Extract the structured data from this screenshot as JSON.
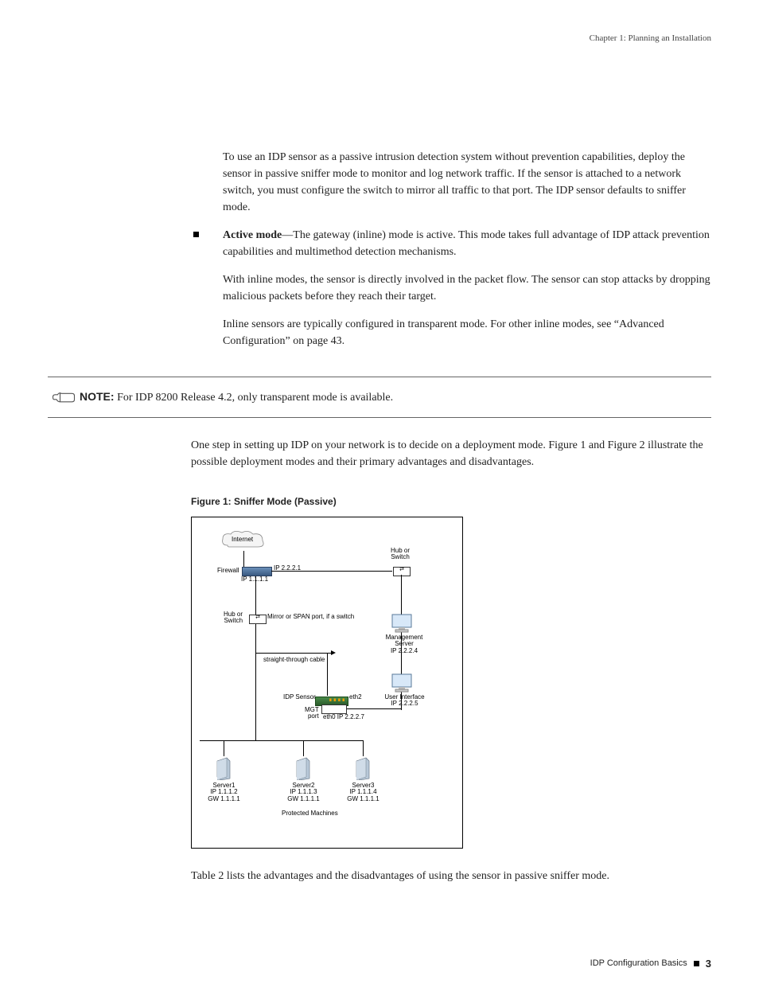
{
  "header": {
    "chapter": "Chapter 1: Planning an Installation"
  },
  "para_intro": "To use an IDP sensor as a passive intrusion detection system without prevention capabilities, deploy the sensor in passive sniffer mode to monitor and log network traffic. If the sensor is attached to a network switch, you must configure the switch to mirror all traffic to that port. The IDP sensor defaults to sniffer mode.",
  "bullet": {
    "lead": "Active mode",
    "lead_rest": "—The gateway (inline) mode is active. This mode takes full advantage of IDP attack prevention capabilities and multimethod detection mechanisms.",
    "p2": "With inline modes, the sensor is directly involved in the packet flow. The sensor can stop attacks by dropping malicious packets before they reach their target.",
    "p3": "Inline sensors are typically configured in transparent mode. For other inline modes, see “Advanced Configuration” on page 43."
  },
  "note": {
    "label": "NOTE:",
    "text": " For IDP 8200 Release 4.2, only transparent mode is available."
  },
  "para_mid": "One step in setting up IDP on your network is to decide on a deployment mode. Figure 1 and Figure 2 illustrate the possible deployment modes and their primary advantages and disadvantages.",
  "figure1": {
    "caption": "Figure 1:  Sniffer Mode (Passive)"
  },
  "diagram": {
    "internet": "Internet",
    "firewall": "Firewall",
    "ip_fw_right": "IP 2.2.2.1",
    "ip_fw_bottom": "IP 1.1.1.1",
    "hub_left": "Hub or\nSwitch",
    "hub_right": "Hub or\nSwitch",
    "mirror": "Mirror or SPAN port, if a switch",
    "straight": "straight-through cable",
    "idp": "IDP Sensor",
    "eth2": "eth2",
    "mgt": "MGT\nport",
    "eth0": "eth0 IP 2.2.2.7",
    "mgmt_server": "Management\nServer\nIP 2.2.2.4",
    "ui": "User Interface\nIP 2.2.2.5",
    "server1": "Server1\nIP 1.1.1.2\nGW 1.1.1.1",
    "server2": "Server2\nIP 1.1.1.3\nGW 1.1.1.1",
    "server3": "Server3\nIP 1.1.1.4\nGW 1.1.1.1",
    "protected": "Protected Machines"
  },
  "para_end": "Table 2 lists the advantages and the disadvantages of using the sensor in passive sniffer mode.",
  "footer": {
    "section": "IDP Configuration Basics",
    "page": "3"
  }
}
